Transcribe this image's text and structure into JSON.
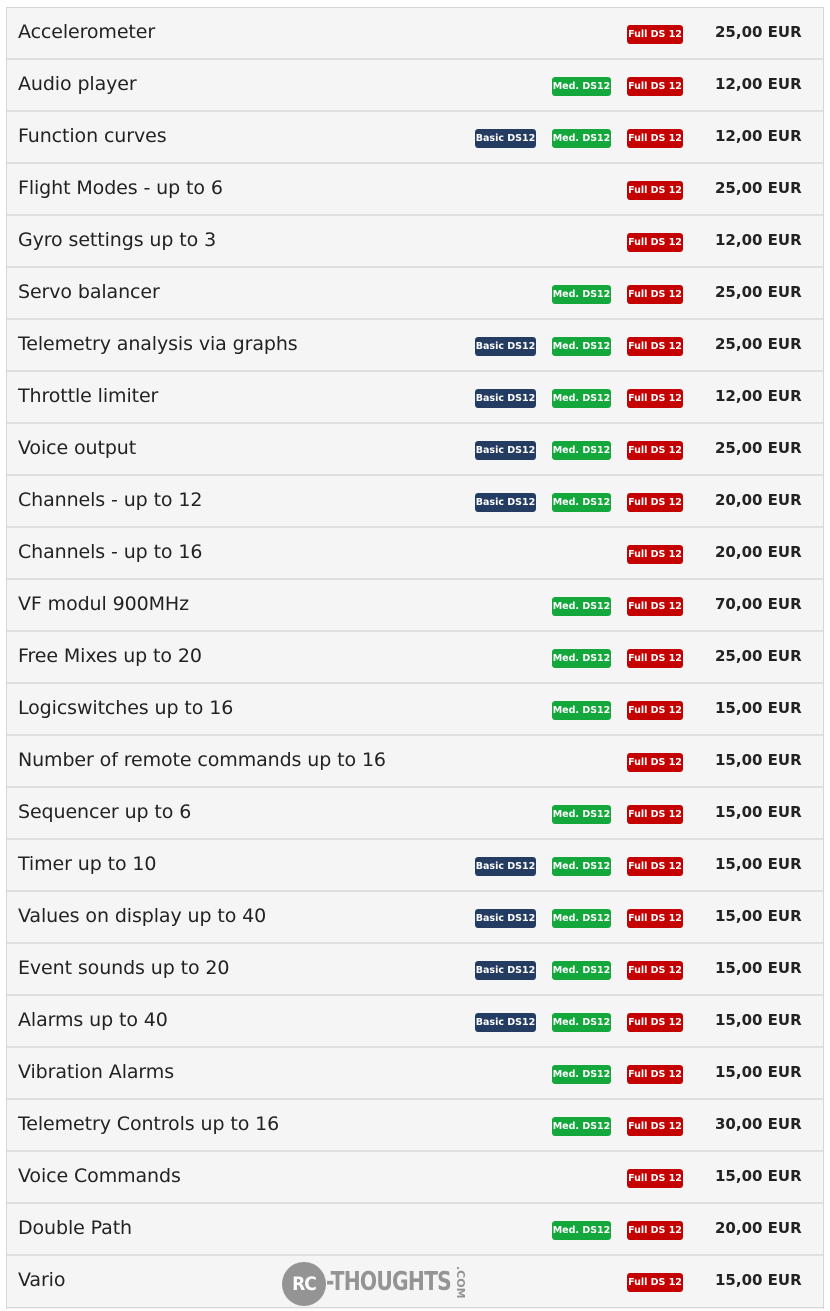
{
  "colors": {
    "basic_badge": "#253c62",
    "med_badge": "#14a83c",
    "full_badge": "#c40000",
    "row_background": "#f5f5f5"
  },
  "badge_labels": {
    "basic": "Basic DS12",
    "med": "Med. DS12",
    "full": "Full DS 12"
  },
  "features": [
    {
      "name": "Accelerometer",
      "basic": false,
      "med": false,
      "full": true,
      "price": "25,00 EUR"
    },
    {
      "name": "Audio player",
      "basic": false,
      "med": true,
      "full": true,
      "price": "12,00 EUR"
    },
    {
      "name": "Function curves",
      "basic": true,
      "med": true,
      "full": true,
      "price": "12,00 EUR"
    },
    {
      "name": "Flight Modes - up to 6",
      "basic": false,
      "med": false,
      "full": true,
      "price": "25,00 EUR"
    },
    {
      "name": "Gyro settings up to 3",
      "basic": false,
      "med": false,
      "full": true,
      "price": "12,00 EUR"
    },
    {
      "name": "Servo balancer",
      "basic": false,
      "med": true,
      "full": true,
      "price": "25,00 EUR"
    },
    {
      "name": "Telemetry analysis via graphs",
      "basic": true,
      "med": true,
      "full": true,
      "price": "25,00 EUR"
    },
    {
      "name": "Throttle limiter",
      "basic": true,
      "med": true,
      "full": true,
      "price": "12,00 EUR"
    },
    {
      "name": "Voice output",
      "basic": true,
      "med": true,
      "full": true,
      "price": "25,00 EUR"
    },
    {
      "name": "Channels - up to 12",
      "basic": true,
      "med": true,
      "full": true,
      "price": "20,00 EUR"
    },
    {
      "name": "Channels - up to 16",
      "basic": false,
      "med": false,
      "full": true,
      "price": "20,00 EUR"
    },
    {
      "name": "VF modul 900MHz",
      "basic": false,
      "med": true,
      "full": true,
      "price": "70,00 EUR"
    },
    {
      "name": "Free Mixes up to 20",
      "basic": false,
      "med": true,
      "full": true,
      "price": "25,00 EUR"
    },
    {
      "name": "Logicswitches up to 16",
      "basic": false,
      "med": true,
      "full": true,
      "price": "15,00 EUR"
    },
    {
      "name": "Number of remote commands up to 16",
      "basic": false,
      "med": false,
      "full": true,
      "price": "15,00 EUR"
    },
    {
      "name": "Sequencer up to 6",
      "basic": false,
      "med": true,
      "full": true,
      "price": "15,00 EUR"
    },
    {
      "name": "Timer up to 10",
      "basic": true,
      "med": true,
      "full": true,
      "price": "15,00 EUR"
    },
    {
      "name": "Values on display up to 40",
      "basic": true,
      "med": true,
      "full": true,
      "price": "15,00 EUR"
    },
    {
      "name": "Event sounds up to 20",
      "basic": true,
      "med": true,
      "full": true,
      "price": "15,00 EUR"
    },
    {
      "name": "Alarms up to 40",
      "basic": true,
      "med": true,
      "full": true,
      "price": "15,00 EUR"
    },
    {
      "name": "Vibration Alarms",
      "basic": false,
      "med": true,
      "full": true,
      "price": "15,00 EUR"
    },
    {
      "name": "Telemetry Controls up to 16",
      "basic": false,
      "med": true,
      "full": true,
      "price": "30,00 EUR"
    },
    {
      "name": "Voice Commands",
      "basic": false,
      "med": false,
      "full": true,
      "price": "15,00 EUR"
    },
    {
      "name": "Double Path",
      "basic": false,
      "med": true,
      "full": true,
      "price": "20,00 EUR"
    },
    {
      "name": "Vario",
      "basic": false,
      "med": false,
      "full": true,
      "price": "15,00 EUR"
    }
  ],
  "watermark": {
    "logo": "RC",
    "text": "-THOUGHTS",
    "suffix": ".COM"
  }
}
